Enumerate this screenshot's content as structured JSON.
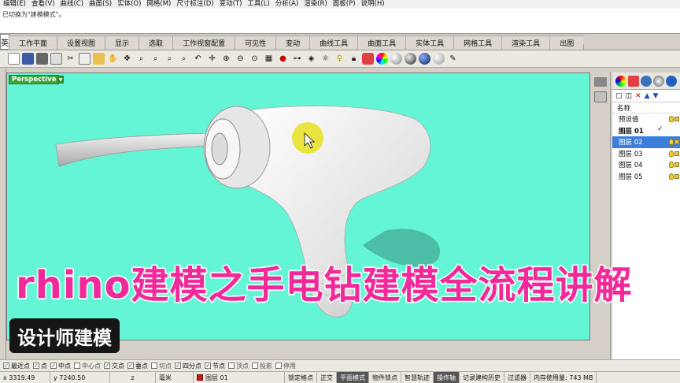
{
  "menu": [
    "编辑(E)",
    "查看(V)",
    "曲线(C)",
    "曲面(S)",
    "实体(O)",
    "网格(M)",
    "尺寸标注(D)",
    "变动(T)",
    "工具(L)",
    "分析(A)",
    "渲染(R)",
    "面板(P)",
    "说明(H)"
  ],
  "command_history": "已切换为\"建模模式\"。",
  "tab_stub": "英",
  "tabs": [
    "工作平面",
    "设置视图",
    "显示",
    "选取",
    "工作视窗配置",
    "可见性",
    "变动",
    "曲线工具",
    "曲面工具",
    "实体工具",
    "网格工具",
    "渲染工具",
    "出图"
  ],
  "viewport": {
    "name": "Perspective",
    "background": "#63f5d6"
  },
  "layers": {
    "header": "名称",
    "rows": [
      {
        "name": "预设值",
        "bold": false,
        "selected": false,
        "current": false
      },
      {
        "name": "图层 01",
        "bold": true,
        "selected": false,
        "current": true
      },
      {
        "name": "图层 02",
        "bold": false,
        "selected": true,
        "current": false
      },
      {
        "name": "图层 03",
        "bold": false,
        "selected": false,
        "current": false
      },
      {
        "name": "图层 04",
        "bold": false,
        "selected": false,
        "current": false
      },
      {
        "name": "图层 05",
        "bold": false,
        "selected": false,
        "current": false
      }
    ],
    "current_mark": "✓"
  },
  "osnap": [
    {
      "label": "最近点",
      "on": true
    },
    {
      "label": "点",
      "on": true
    },
    {
      "label": "中点",
      "on": true
    },
    {
      "label": "中心点",
      "on": false
    },
    {
      "label": "交点",
      "on": true
    },
    {
      "label": "垂点",
      "on": true
    },
    {
      "label": "切点",
      "on": false
    },
    {
      "label": "四分点",
      "on": true
    },
    {
      "label": "节点",
      "on": true
    },
    {
      "label": "顶点",
      "on": false
    },
    {
      "label": "投影",
      "on": false
    },
    {
      "label": "停用",
      "on": false
    }
  ],
  "status": {
    "x": "x 3319.49",
    "y": "y 7240.50",
    "z": "z",
    "unit": "毫米",
    "layer": "图层 01",
    "items": [
      "锁定格点",
      "正交",
      "平面模式",
      "物件锁点",
      "智慧轨迹",
      "操作轴",
      "记录建构历史",
      "过滤器",
      "内存使用量: 743 MB"
    ],
    "active": [
      "平面模式",
      "操作轴"
    ]
  },
  "overlay": {
    "title": "rhino建模之手电钻建模全流程讲解",
    "subtitle": "设计师建模"
  },
  "colors": {
    "title": "#f02a9a",
    "selected": "#3b7fd8",
    "layer_swatch": "#c81818"
  }
}
